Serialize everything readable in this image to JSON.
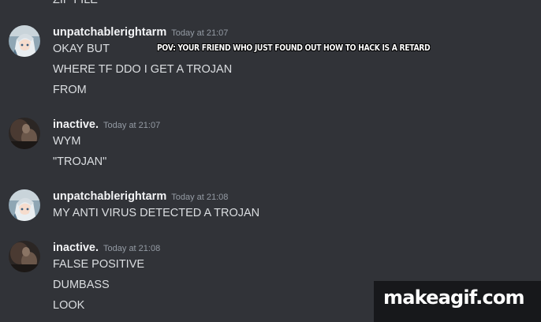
{
  "caption": "POV: YOUR FRIEND WHO JUST FOUND OUT HOW TO HACK IS A RETARD",
  "cut_off_message": "ZIP FILE",
  "messages": [
    {
      "username": "unpatchablerightarm",
      "timestamp": "Today at 21:07",
      "avatar": "anime-avatar-icon",
      "lines": [
        "OKAY BUT",
        "WHERE TF DDO I GET A TROJAN",
        "FROM"
      ]
    },
    {
      "username": "inactive.",
      "timestamp": "Today at 21:07",
      "avatar": "dark-avatar-icon",
      "lines": [
        "WYM",
        "\"TROJAN\""
      ]
    },
    {
      "username": "unpatchablerightarm",
      "timestamp": "Today at 21:08",
      "avatar": "anime-avatar-icon",
      "lines": [
        "MY ANTI VIRUS DETECTED A TROJAN"
      ]
    },
    {
      "username": "inactive.",
      "timestamp": "Today at 21:08",
      "avatar": "dark-avatar-icon",
      "lines": [
        "FALSE POSITIVE",
        "DUMBASS",
        "LOOK"
      ]
    }
  ],
  "watermark": "makeagif.com",
  "colors": {
    "background": "#313338",
    "message_text": "#dbdee1",
    "username": "#f2f3f5",
    "timestamp": "#949ba4"
  }
}
